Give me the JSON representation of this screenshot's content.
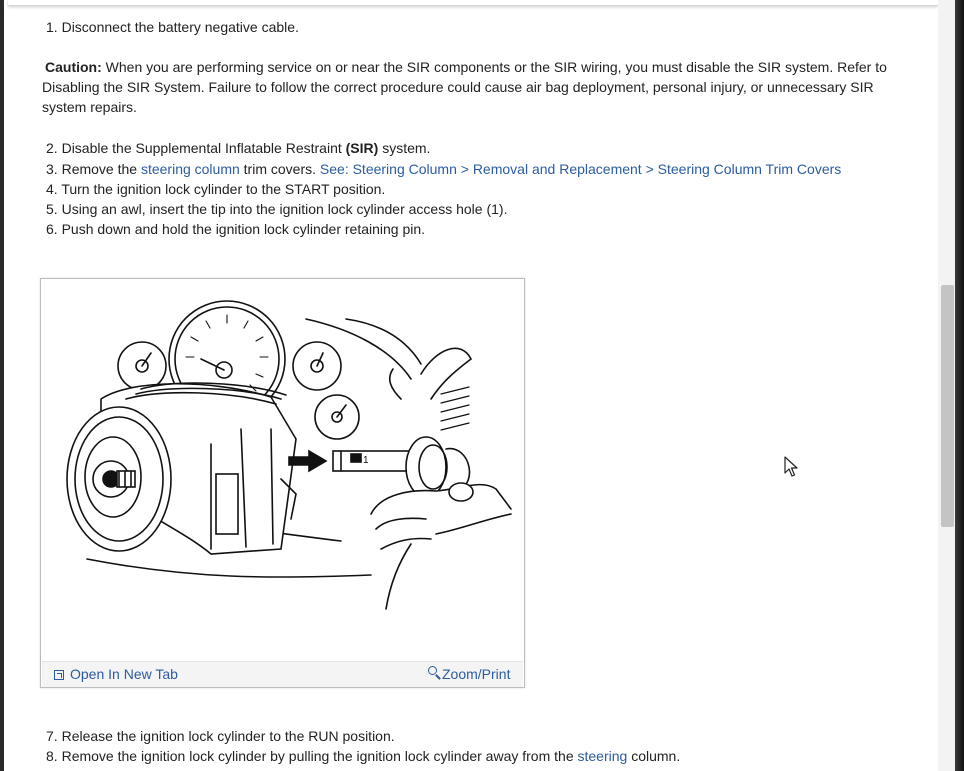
{
  "steps_top": [
    {
      "num": "1.",
      "text": "Disconnect the battery negative cable."
    }
  ],
  "caution": {
    "label": "Caution:",
    "text": " When you are performing service on or near the SIR components or the SIR wiring, you must disable the SIR system. Refer to Disabling the SIR System. Failure to follow the correct procedure could cause air bag deployment, personal injury, or unnecessary SIR system repairs."
  },
  "steps": [
    {
      "num": "2.",
      "pre": "Disable the Supplemental Inflatable Restraint ",
      "bold": "(SIR)",
      "post": " system."
    },
    {
      "num": "3.",
      "pre": "Remove the ",
      "link1": "steering column",
      "mid": " trim covers. ",
      "link2": "See: Steering Column > Removal and Replacement > Steering Column Trim Covers"
    },
    {
      "num": "4.",
      "text": "Turn the ignition lock cylinder to the START position."
    },
    {
      "num": "5.",
      "text": "Using an awl, insert the tip into the ignition lock cylinder access hole (1)."
    },
    {
      "num": "6.",
      "text": "Push down and hold the ignition lock cylinder retaining pin."
    }
  ],
  "figure": {
    "open_label": "Open In New Tab",
    "zoom_label": "Zoom/Print",
    "callout": "1"
  },
  "steps_bottom": [
    {
      "num": "7.",
      "text": "Release the ignition lock cylinder to the RUN position."
    },
    {
      "num": "8.",
      "pre": "Remove the ignition lock cylinder by pulling the ignition lock cylinder away from the ",
      "link": "steering",
      "post": " column."
    }
  ],
  "colors": {
    "link": "#2c5c9e",
    "scrollthumb": "#c4c4c4"
  },
  "icons": [
    "open-new-tab-icon",
    "zoom-icon",
    "mouse-pointer-icon"
  ]
}
